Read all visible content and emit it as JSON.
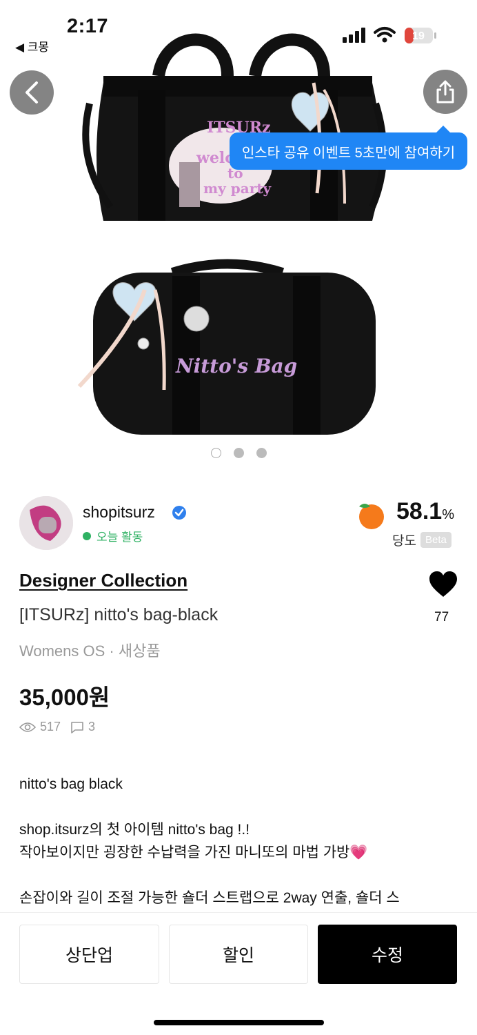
{
  "status_bar": {
    "time": "2:17",
    "back_app": "◀ 크몽",
    "battery": "19"
  },
  "hero": {
    "tooltip": "인스타 공유 이벤트 5초만에 참여하기",
    "image_top_text_1": "ITSURz",
    "image_top_text_2": "welcome",
    "image_top_text_3": "to",
    "image_top_text_4": "my party",
    "image_bottom_text": "Nitto's Bag",
    "current_image": 1,
    "image_count": 3
  },
  "seller": {
    "name": "shopitsurz",
    "activity": "오늘 활동",
    "score_value": "58.1",
    "score_unit": "%",
    "score_label": "당도",
    "beta": "Beta"
  },
  "product": {
    "category": "Designer Collection",
    "title": "[ITSURz] nitto's bag-black",
    "meta": "Womens OS · 새상품",
    "price": "35,000원",
    "likes": "77",
    "views": "517",
    "comments": "3",
    "description": [
      "nitto's bag black",
      "",
      "shop.itsurz의 첫 아이템 nitto's bag !.!",
      "작아보이지만 굉장한 수납력을 가진 마니또의 마법 가방💗",
      "",
      "손잡이와 길이 조절 가능한 숄더 스트랩으로 2way 연출, 숄더 스"
    ]
  },
  "actions": {
    "bump": "상단업",
    "discount": "할인",
    "edit": "수정"
  },
  "colors": {
    "accent_blue": "#1f86f5",
    "active_green": "#2fb163",
    "primary_black": "#000000"
  }
}
